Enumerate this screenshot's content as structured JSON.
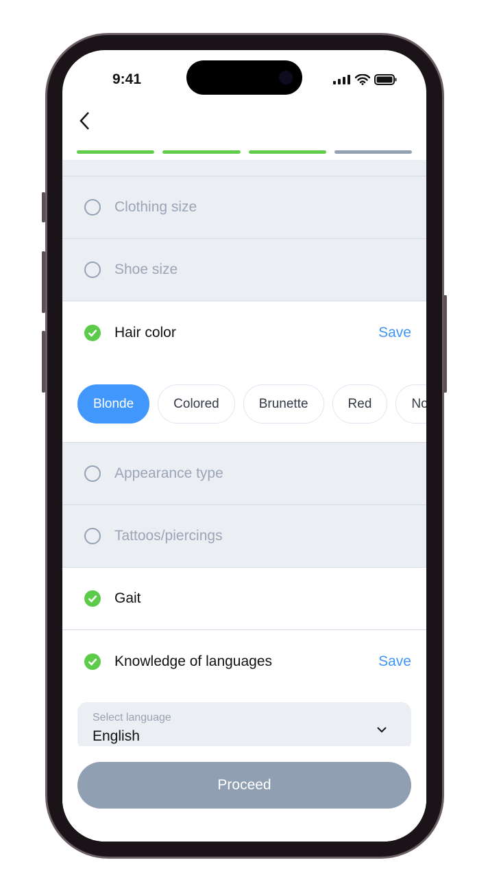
{
  "status_bar": {
    "time": "9:41"
  },
  "progress": {
    "steps_total": 4,
    "steps_completed": 3,
    "colors": {
      "done": "#62cc4b",
      "pending": "#93a1b3"
    }
  },
  "rows_top": [
    {
      "label": "Clothing size",
      "checked": false
    },
    {
      "label": "Shoe size",
      "checked": false
    }
  ],
  "hair": {
    "label": "Hair color",
    "save": "Save",
    "chips": [
      "Blonde",
      "Colored",
      "Brunette",
      "Red",
      "No"
    ],
    "selected": "Blonde"
  },
  "rows_mid": [
    {
      "label": "Appearance type",
      "checked": false
    },
    {
      "label": "Tattoos/piercings",
      "checked": false
    },
    {
      "label": "Gait",
      "checked": true
    }
  ],
  "languages": {
    "label": "Knowledge of languages",
    "save": "Save",
    "select_label": "Select language",
    "select_value": "English"
  },
  "proceed": "Proceed",
  "colors": {
    "accent": "#4197fb",
    "check": "#5ccb4a",
    "muted": "#9aa5b7"
  }
}
